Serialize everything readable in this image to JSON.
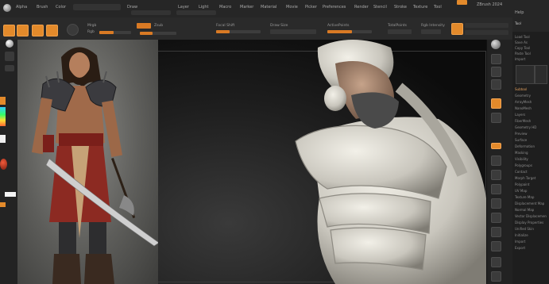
{
  "title": "ZBrush 2024",
  "menu": {
    "items": [
      "Alpha",
      "Brush",
      "Color",
      "Document",
      "Draw",
      "Edit",
      "File",
      "Layer",
      "Light",
      "Macro",
      "Marker",
      "Material",
      "Movie",
      "Picker",
      "Preferences",
      "Render",
      "Stencil",
      "Stroke",
      "Texture",
      "Tool",
      "Transform",
      "Zplugin",
      "Zscript",
      "Help"
    ],
    "project_label": "QuickSave",
    "version_label": "ZBrush 2024"
  },
  "toolbar": {
    "edit_label": "Edit",
    "draw_label": "Draw",
    "move_label": "Move",
    "scale_label": "Scale",
    "rotate_label": "Rotate",
    "mrgb_label": "Mrgb",
    "rgb_label": "Rgb",
    "m_label": "M",
    "zadd_label": "Zadd",
    "zsub_label": "Zsub",
    "focal_label": "Focal Shift",
    "drawsize_label": "Draw Size",
    "zintensity_label": "Z Intensity",
    "rgb_intensity_label": "Rgb Intensity",
    "activepoints_label": "ActivePoints",
    "totalpoints_label": "TotalPoints",
    "drawsize_value": 0.55,
    "zintensity_value": 0.35,
    "focal_value": 0.3,
    "rgb_value": 0.45
  },
  "tray": {
    "header": "Tool",
    "rows": [
      "Load Tool",
      "Save As",
      "Copy Tool",
      "Paste Tool",
      "Import",
      "Export",
      "Clone",
      "Make PolyMesh3D",
      "GoZ",
      "All",
      "Visible",
      "R",
      "Lightbox Tools",
      "Subtool",
      "Geometry",
      "ArrayMesh",
      "NanoMesh",
      "Layers",
      "FiberMesh",
      "Geometry HD",
      "Preview",
      "Surface",
      "Deformation",
      "Masking",
      "Visibility",
      "Polygroups",
      "Contact",
      "Morph Target",
      "Polypaint",
      "UV Map",
      "Texture Map",
      "Displacement Map",
      "Normal Map",
      "Vector Displacement Map",
      "Display Properties",
      "Unified Skin",
      "Initialize",
      "Import",
      "Export"
    ]
  },
  "colors": {
    "accent": "#e38a2b",
    "panel": "#262626",
    "viewport": "#111111"
  }
}
